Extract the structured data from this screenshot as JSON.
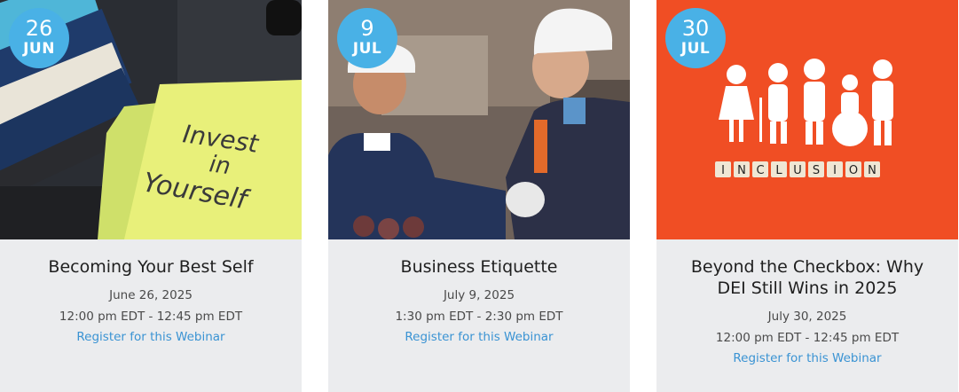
{
  "colors": {
    "badge": "#49b1e6",
    "card_bg": "#ebecee",
    "link": "#3a93d3",
    "title": "#1f1f1f"
  },
  "cards": [
    {
      "day": "26",
      "month": "JUN",
      "image": "sticky-note-invest-in-yourself",
      "note_lines": [
        "Invest",
        "in",
        "Yourself"
      ],
      "title": "Becoming Your Best Self",
      "date": "June 26, 2025",
      "time": "12:00 pm EDT - 12:45 pm EDT",
      "link": "Register for this Webinar"
    },
    {
      "day": "9",
      "month": "JUL",
      "image": "workers-handshake",
      "title": "Business Etiquette",
      "date": "July 9, 2025",
      "time": "1:30 pm EDT - 2:30 pm EDT",
      "link": "Register for this Webinar"
    },
    {
      "day": "30",
      "month": "JUL",
      "image": "inclusion-paper-people",
      "tiles": [
        "I",
        "N",
        "C",
        "L",
        "U",
        "S",
        "I",
        "O",
        "N"
      ],
      "title": "Beyond the Checkbox: Why DEI Still Wins in 2025",
      "date": "July 30, 2025",
      "time": "12:00 pm EDT - 12:45 pm EDT",
      "link": "Register for this Webinar"
    }
  ]
}
